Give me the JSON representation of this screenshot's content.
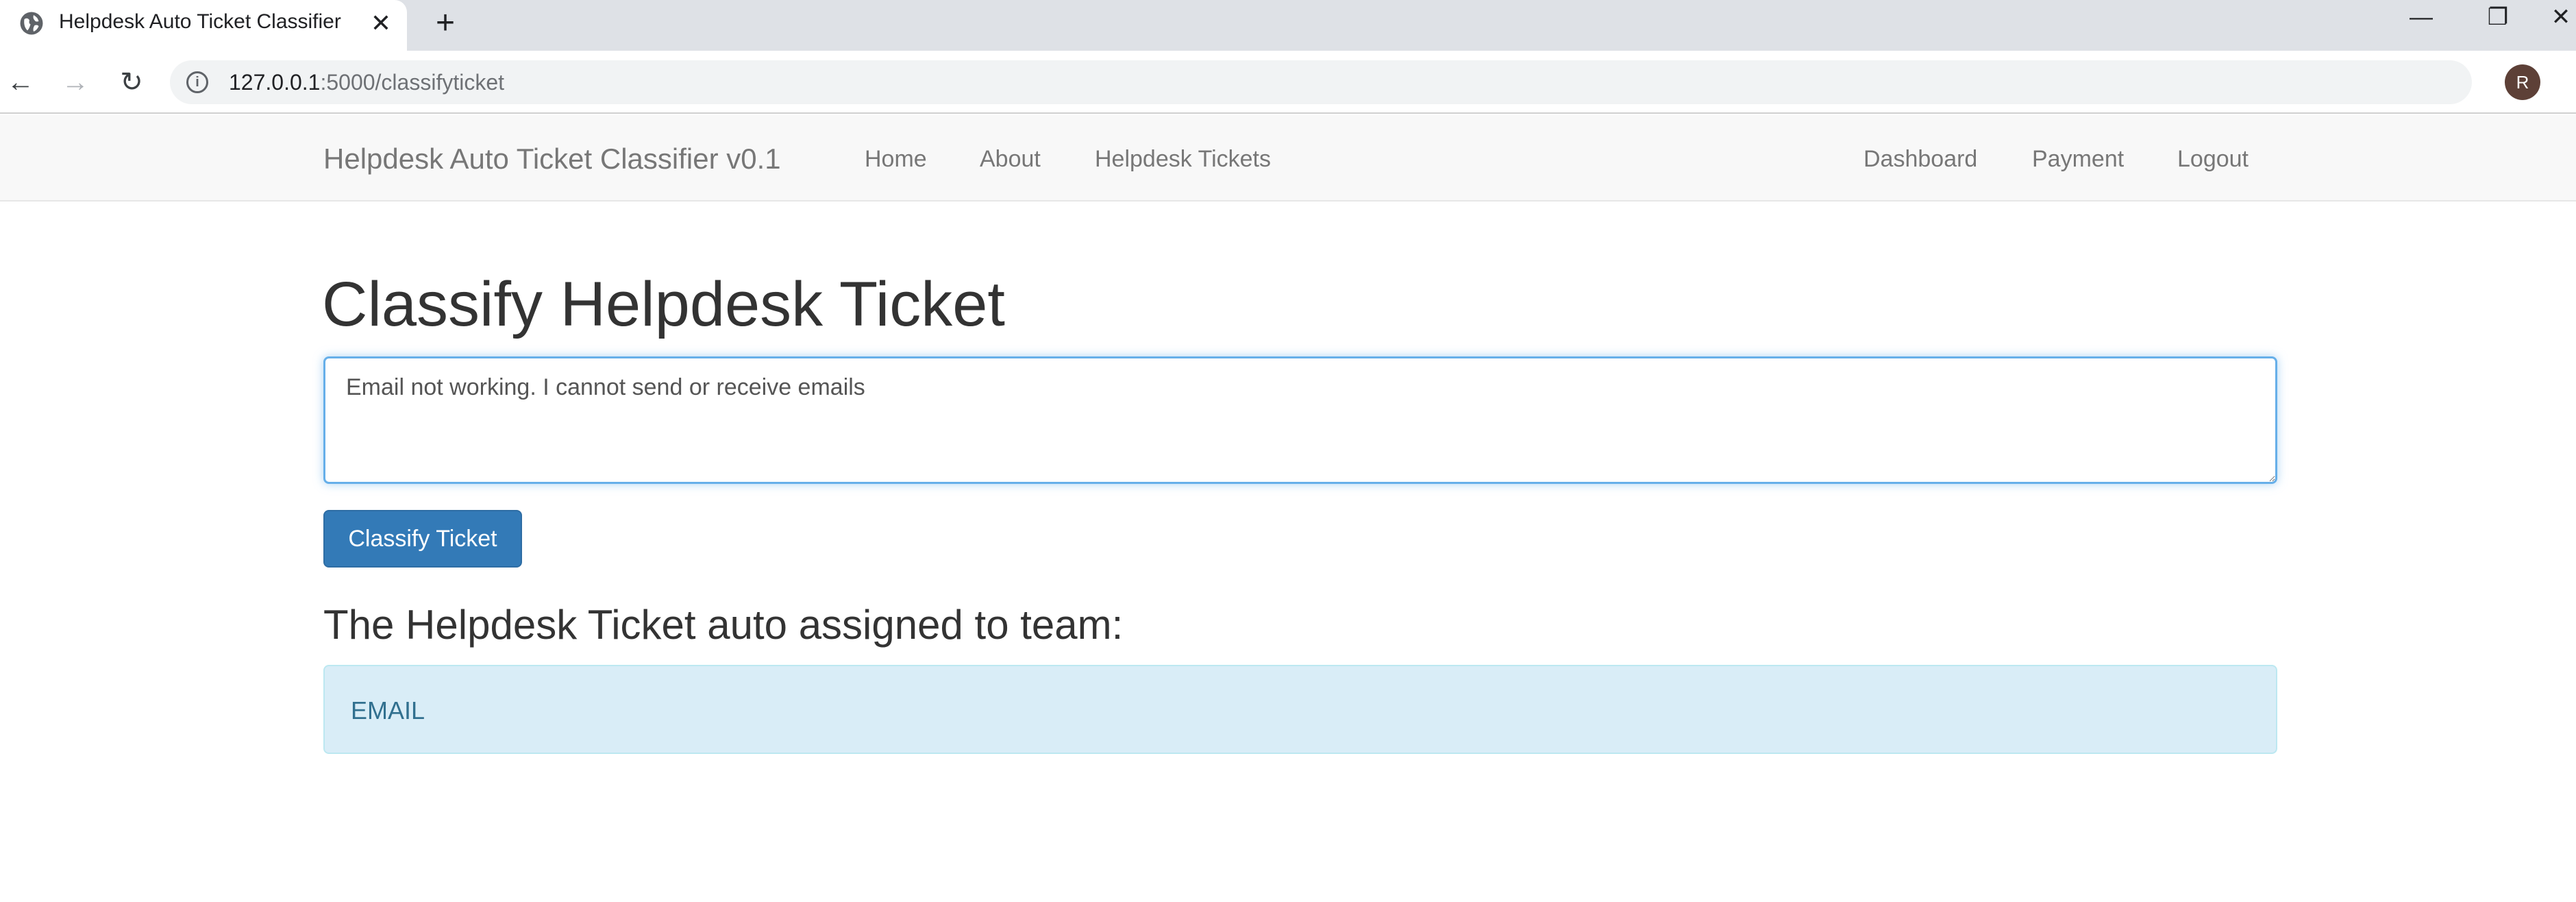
{
  "browser": {
    "tab_title": "Helpdesk Auto Ticket Classifier",
    "new_tab_symbol": "+",
    "url_host": "127.0.0.1",
    "url_path": ":5000/classifyticket",
    "profile_initial": "R",
    "icons": {
      "favicon": "globe-icon",
      "back": "arrow-left-icon",
      "forward": "arrow-right-icon",
      "reload": "reload-icon",
      "info": "info-icon",
      "bookmark": "star-icon"
    }
  },
  "navbar": {
    "brand": "Helpdesk Auto Ticket Classifier v0.1",
    "left_links": [
      "Home",
      "About",
      "Helpdesk Tickets"
    ],
    "right_links": [
      "Dashboard",
      "Payment",
      "Logout"
    ]
  },
  "main": {
    "heading": "Classify Helpdesk Ticket",
    "ticket_text": "Email not working. I cannot send or receive emails",
    "submit_label": "Classify Ticket",
    "result_heading": "The Helpdesk Ticket auto assigned to team:",
    "result_value": "EMAIL"
  },
  "colors": {
    "primary_button": "#337ab7",
    "alert_info_bg": "#d9edf7",
    "alert_info_text": "#31708f",
    "focus_border": "#66afe9"
  }
}
